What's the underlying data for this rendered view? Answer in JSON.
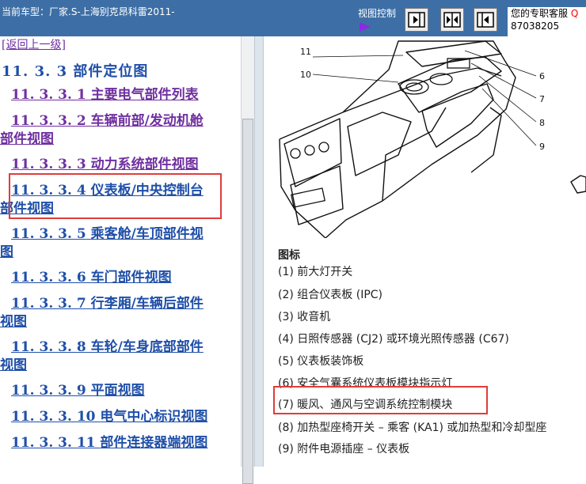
{
  "topbar": {
    "vehicle_label": "当前车型：厂家.S-上海别克昂科雷2011-",
    "view_control_label": "视图控制",
    "support_line1": "您的专职客服",
    "support_q": "Q",
    "support_line2": "87038205"
  },
  "left_nav": {
    "back_link": "[返回上一级]",
    "section_title": "11. 3. 3 部件定位图",
    "items": [
      {
        "num": "11. 3. 3. 1",
        "title": "主要电气部件列表",
        "line2": ""
      },
      {
        "num": "11. 3. 3. 2",
        "title": "车辆前部/发动机舱",
        "line2": "部件视图"
      },
      {
        "num": "11. 3. 3. 3",
        "title": "动力系统部件视图",
        "line2": ""
      },
      {
        "num": "11. 3. 3. 4",
        "title": "仪表板/中央控制台",
        "line2": "部件视图"
      },
      {
        "num": "11. 3. 3. 5",
        "title": "乘客舱/车顶部件视",
        "line2": "图"
      },
      {
        "num": "11. 3. 3. 6",
        "title": "车门部件视图",
        "line2": ""
      },
      {
        "num": "11. 3. 3. 7",
        "title": "行李厢/车辆后部件",
        "line2": "视图"
      },
      {
        "num": "11. 3. 3. 8",
        "title": "车轮/车身底部部件",
        "line2": "视图"
      },
      {
        "num": "11. 3. 3. 9",
        "title": "平面视图",
        "line2": ""
      },
      {
        "num": "11. 3. 3. 10",
        "title": "电气中心标识视图",
        "line2": ""
      },
      {
        "num": "11. 3. 3. 11",
        "title": "部件连接器端视图",
        "line2": ""
      }
    ]
  },
  "diagram": {
    "callouts": [
      "11",
      "10",
      "6",
      "7",
      "8",
      "9"
    ]
  },
  "legend": {
    "title": "图标",
    "items": [
      "(1) 前大灯开关",
      "(2) 组合仪表板 (IPC)",
      "(3) 收音机",
      "(4) 日照传感器 (CJ2) 或环境光照传感器 (C67)",
      "(5) 仪表板装饰板",
      "(6) 安全气囊系统仪表板模块指示灯",
      "(7) 暖风、通风与空调系统控制模块",
      "(8) 加热型座椅开关 – 乘客 (KA1) 或加热型和冷却型座",
      "(9) 附件电源插座 – 仪表板"
    ]
  },
  "colors": {
    "topbar": "#3d6fa6",
    "link_visited": "#7030a0",
    "link": "#1f4fa8",
    "highlight_box": "#e03c3c"
  }
}
